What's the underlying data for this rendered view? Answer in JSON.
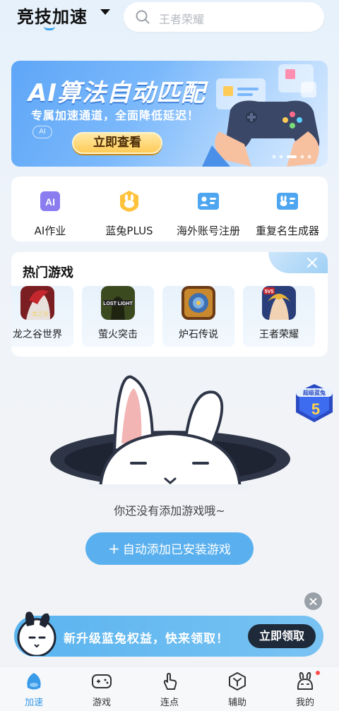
{
  "header": {
    "app_title": "竞技加速",
    "search_placeholder": "王者荣耀"
  },
  "banner": {
    "headline": "AI算法自动匹配",
    "subtitle": "专属加速通道，全面降低延迟！",
    "button_label": "立即查看",
    "badge": "AI"
  },
  "quick_actions": [
    {
      "label": "AI作业",
      "icon": "ai-icon"
    },
    {
      "label": "蓝兔PLUS",
      "icon": "rabbit-shield-icon"
    },
    {
      "label": "海外账号注册",
      "icon": "id-card-icon"
    },
    {
      "label": "重复名生成器",
      "icon": "rabbit-card-icon"
    }
  ],
  "hot_games": {
    "title": "热门游戏",
    "games": [
      {
        "name": "龙之谷世界",
        "icon": "dragon-nest-icon"
      },
      {
        "name": "萤火突击",
        "icon": "lost-light-icon"
      },
      {
        "name": "炉石传说",
        "icon": "hearthstone-icon"
      },
      {
        "name": "王者荣耀",
        "icon": "honor-of-kings-icon"
      }
    ]
  },
  "empty_state": {
    "message": "你还没有添加游戏哦~",
    "button_label": "自动添加已安装游戏"
  },
  "promo": {
    "text": "新升级蓝兔权益，快来领取！",
    "button_label": "立即领取"
  },
  "float_badge": {
    "text": "超级蓝兔",
    "number": "5"
  },
  "bottom_nav": [
    {
      "label": "加速",
      "icon": "speed-icon",
      "active": true
    },
    {
      "label": "游戏",
      "icon": "gamepad-icon",
      "active": false
    },
    {
      "label": "连点",
      "icon": "tap-icon",
      "active": false
    },
    {
      "label": "辅助",
      "icon": "cube-icon",
      "active": false
    },
    {
      "label": "我的",
      "icon": "rabbit-face-icon",
      "active": false
    }
  ],
  "colors": {
    "accent": "#5ab0ee",
    "nav_active": "#3a9be8",
    "promo_button": "#1e2a3a"
  }
}
